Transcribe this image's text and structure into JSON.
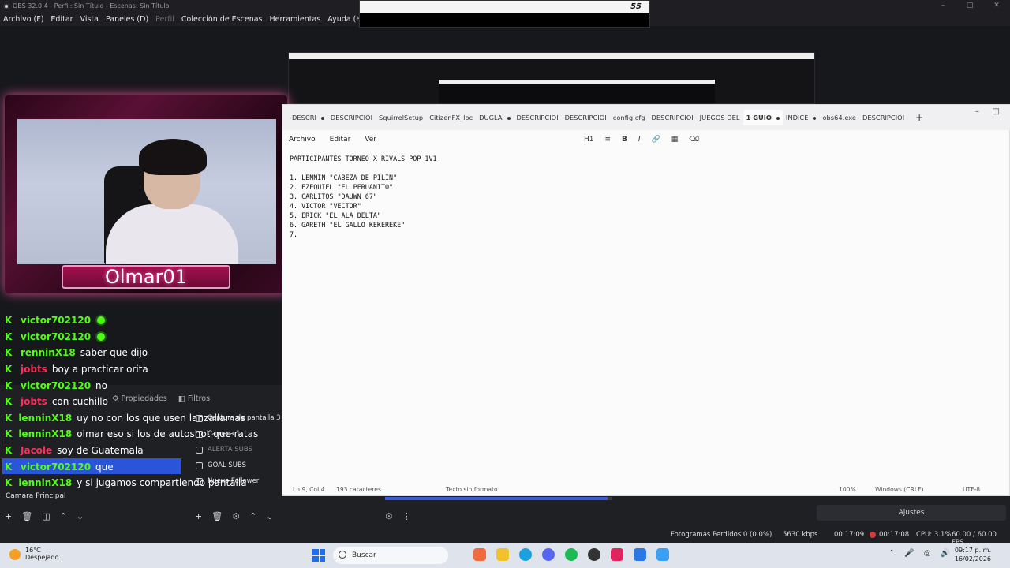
{
  "obs": {
    "title": "OBS 32.0.4 - Perfil: Sin Título - Escenas: Sin Título",
    "menu": [
      "Archivo (F)",
      "Editar",
      "Vista",
      "Paneles (D)",
      "Perfil",
      "Colección de Escenas",
      "Herramientas",
      "Ayuda (H)"
    ],
    "capture_badge": "55",
    "camera_name": "Olmar01",
    "toolbar": {
      "properties": "Propiedades",
      "filters": "Filtros"
    },
    "sources": [
      {
        "label": "Captura de pantalla 3",
        "dim": false
      },
      {
        "label": "Camara 1",
        "dim": false
      },
      {
        "label": "ALERTA SUBS",
        "dim": true
      },
      {
        "label": "GOAL SUBS",
        "dim": false
      },
      {
        "label": "Nuevo Follower",
        "dim": false
      }
    ],
    "scene_current": "Camara Principal",
    "settings_button": "Ajustes",
    "status": {
      "dropped_frames": "Fotogramas Perdidos 0 (0.0%)",
      "bitrate": "5630 kbps",
      "stream_time": "00:17:09",
      "rec_time": "00:17:08",
      "cpu": "CPU: 3.1%",
      "fps": "60.00 / 60.00 FPS"
    },
    "colors": {
      "accent": "#2b55d8",
      "kick_green": "#53fc18",
      "rec": "#d83b3b"
    }
  },
  "chat": [
    {
      "user": "victor702120",
      "color": "#53fc18",
      "msg": "",
      "emote": true
    },
    {
      "user": "victor702120",
      "color": "#53fc18",
      "msg": "",
      "emote": true
    },
    {
      "user": "renninX18",
      "color": "#53fc18",
      "msg": "saber que dijo",
      "emote": false
    },
    {
      "user": "jobts",
      "color": "#ff2e5b",
      "msg": "boy a practicar orita",
      "emote": false
    },
    {
      "user": "victor702120",
      "color": "#53fc18",
      "msg": "no",
      "emote": false
    },
    {
      "user": "jobts",
      "color": "#ff2e5b",
      "msg": "con cuchillo",
      "emote": false
    },
    {
      "user": "lenninX18",
      "color": "#53fc18",
      "msg": "uy no con los que usen lanzallamas",
      "emote": false
    },
    {
      "user": "lenninX18",
      "color": "#53fc18",
      "msg": "olmar eso si los de autoshot que ratas",
      "emote": false
    },
    {
      "user": "Jacole",
      "color": "#ff2e5b",
      "msg": "soy de Guatemala",
      "emote": false
    },
    {
      "user": "victor702120",
      "color": "#53fc18",
      "msg": "que",
      "emote": false
    },
    {
      "user": "lenninX18",
      "color": "#53fc18",
      "msg": "y si jugamos compartiendo pantalla",
      "emote": false
    }
  ],
  "notepad": {
    "tabs": [
      "DESCRI",
      "DESCRIPCIOI",
      "SquirrelSetup",
      "CitizenFX_loc",
      "DUGLA",
      "DESCRIPCIOI",
      "DESCRIPCIOI",
      "config.cfg",
      "DESCRIPCIOI",
      "JUEGOS DEL",
      "1 GUIO",
      "INDICE",
      "obs64.exe",
      "DESCRIPCIOI"
    ],
    "active_tab": 10,
    "menu": [
      "Archivo",
      "Editar",
      "Ver"
    ],
    "format": {
      "heading": "H1",
      "bold": "B",
      "italic": "I"
    },
    "heading": "PARTICIPANTES TORNEO X RIVALS POP 1V1",
    "lines": [
      "1. LENNIN \"CABEZA DE PILIN\"",
      "2. EZEQUIEL \"EL PERUANITO\"",
      "3. CARLITOS \"DAUWN 67\"",
      "4. VICTOR \"VECTOR\"",
      "5. ERICK \"EL ALA DELTA\"",
      "6. GARETH \"EL GALLO KEKEREKE\"",
      "7."
    ],
    "status": {
      "position": "Ln 9, Col 4",
      "chars": "193 caracteres.",
      "format": "Texto sin formato",
      "zoom": "100%",
      "eol": "Windows (CRLF)",
      "encoding": "UTF-8"
    }
  },
  "taskbar": {
    "temp": "16°C",
    "weather": "Despejado",
    "search": "Buscar",
    "time": "09:17 p. m.",
    "date": "16/02/2026"
  }
}
